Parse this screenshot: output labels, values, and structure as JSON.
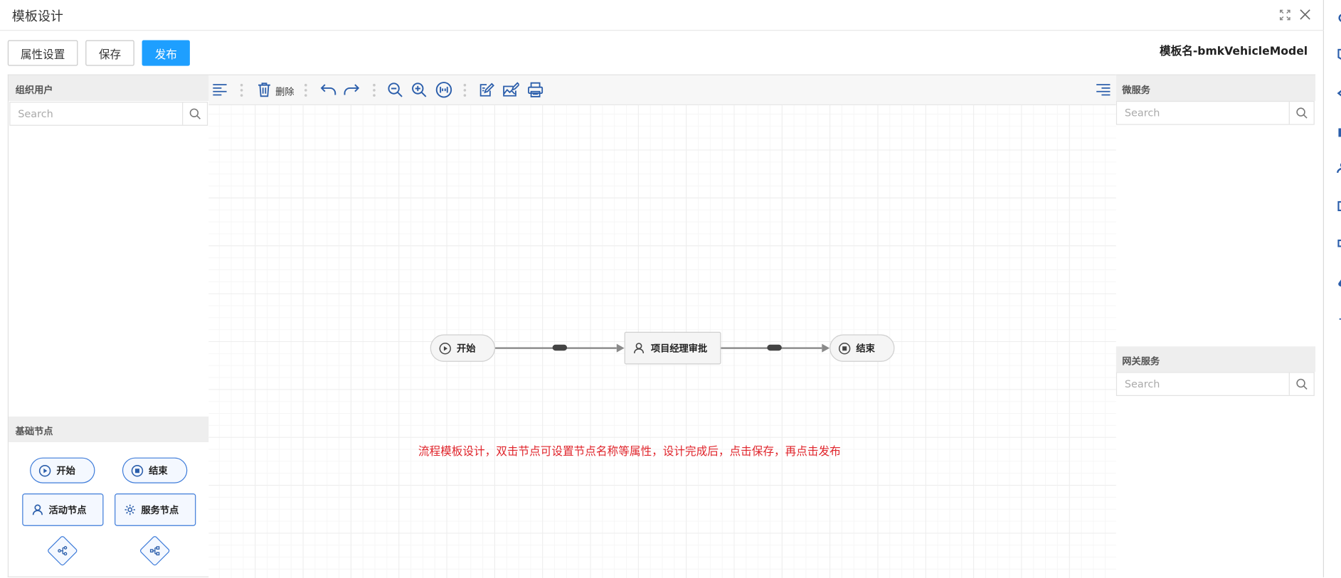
{
  "window": {
    "title": "模板设计",
    "maximize_icon": "expand-icon",
    "close_icon": "close-icon"
  },
  "actions": {
    "properties_label": "属性设置",
    "save_label": "保存",
    "publish_label": "发布"
  },
  "model_name": "模板名-bmkVehicleModel",
  "left_panel": {
    "org_users_title": "组织用户",
    "search_placeholder": "Search",
    "basic_nodes_title": "基础节点",
    "nodes": {
      "start": "开始",
      "end": "结束",
      "activity": "活动节点",
      "service": "服务节点"
    },
    "gateways": [
      "parallel-gateway-icon",
      "exclusive-gateway-icon"
    ]
  },
  "toolbar": {
    "delete_label": "删除",
    "icons": [
      "align-left-icon",
      "trash-icon",
      "undo-icon",
      "redo-icon",
      "zoom-out-icon",
      "zoom-in-icon",
      "fit-icon",
      "edit-icon",
      "image-edit-icon",
      "print-icon",
      "outline-icon"
    ]
  },
  "canvas": {
    "nodes": {
      "start": "开始",
      "approval": "项目经理审批",
      "end": "结束"
    },
    "hint": "流程模板设计，双击节点可设置节点名称等属性，设计完成后，点击保存，再点击发布"
  },
  "right_panel": {
    "micro_services_title": "微服务",
    "micro_search_placeholder": "Search",
    "gateway_services_title": "网关服务",
    "gateway_search_placeholder": "Search"
  },
  "colors": {
    "primary": "#1e9fff",
    "node_border": "#3d7bd9",
    "icon_blue": "#2b5eab",
    "hint_red": "#e0242b"
  }
}
